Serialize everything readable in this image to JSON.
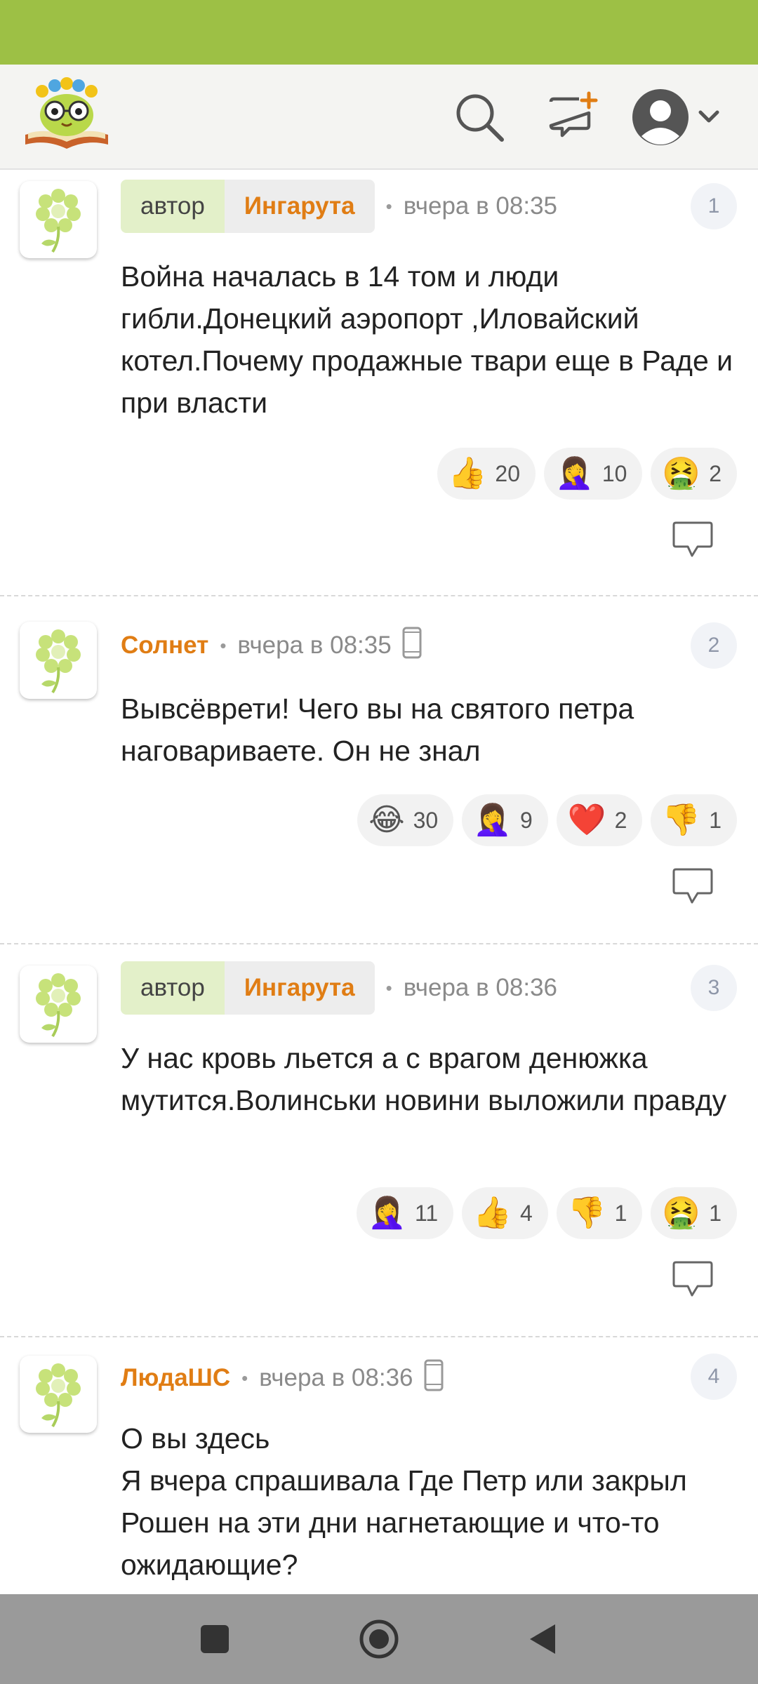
{
  "header": {
    "logo_icon": "reading-owl-logo-icon",
    "search_icon": "search-icon",
    "new_post_icon": "new-post-icon",
    "profile_icon": "user-avatar-icon"
  },
  "colors": {
    "status_bar": "#9dc045",
    "accent_orange": "#e07d14",
    "author_tag_bg": "#e3f0c9"
  },
  "comments": [
    {
      "author_label": "автор",
      "username": "Ингарута",
      "time": "вчера в 08:35",
      "number": "1",
      "text": "Война началась в 14 том и люди гибли.Донецкий аэропорт ,Иловайский котел.Почему продажные твари еще в Раде и при власти",
      "reactions": [
        {
          "icon": "thumbs-up-icon",
          "emoji": "👍",
          "count": "20"
        },
        {
          "icon": "facepalm-icon",
          "emoji": "🤦‍♀️",
          "count": "10"
        },
        {
          "icon": "nauseated-face-icon",
          "emoji": "🤮",
          "count": "2"
        }
      ]
    },
    {
      "username": "Солнет",
      "time": "вчера в 08:35",
      "number": "2",
      "text": "Вывсёврети! Чего вы на святого петра наговариваете. Он не знал",
      "reactions": [
        {
          "icon": "laughing-tears-icon",
          "emoji": "😂",
          "count": "30"
        },
        {
          "icon": "facepalm-icon",
          "emoji": "🤦‍♀️",
          "count": "9"
        },
        {
          "icon": "red-heart-icon",
          "emoji": "❤️",
          "count": "2"
        },
        {
          "icon": "thumbs-down-icon",
          "emoji": "👎",
          "count": "1"
        }
      ]
    },
    {
      "author_label": "автор",
      "username": "Ингарута",
      "time": "вчера в 08:36",
      "number": "3",
      "text": "У нас кровь льется а с врагом денюжка мутится.Волинськи новини выложили правду",
      "reactions": [
        {
          "icon": "facepalm-icon",
          "emoji": "🤦‍♀️",
          "count": "11"
        },
        {
          "icon": "thumbs-up-icon",
          "emoji": "👍",
          "count": "4"
        },
        {
          "icon": "thumbs-down-icon",
          "emoji": "👎",
          "count": "1"
        },
        {
          "icon": "nauseated-face-icon",
          "emoji": "🤮",
          "count": "1"
        }
      ]
    },
    {
      "username": "ЛюдаШС",
      "time": "вчера в 08:36",
      "number": "4",
      "text": "О вы здесь\nЯ вчера спрашивала Где Петр или закрыл Рошен на эти дни нагнетающие и что-то ожидающие?"
    }
  ],
  "navbar": {
    "recents_icon": "square-recents-icon",
    "home_icon": "circle-home-icon",
    "back_icon": "triangle-back-icon"
  }
}
